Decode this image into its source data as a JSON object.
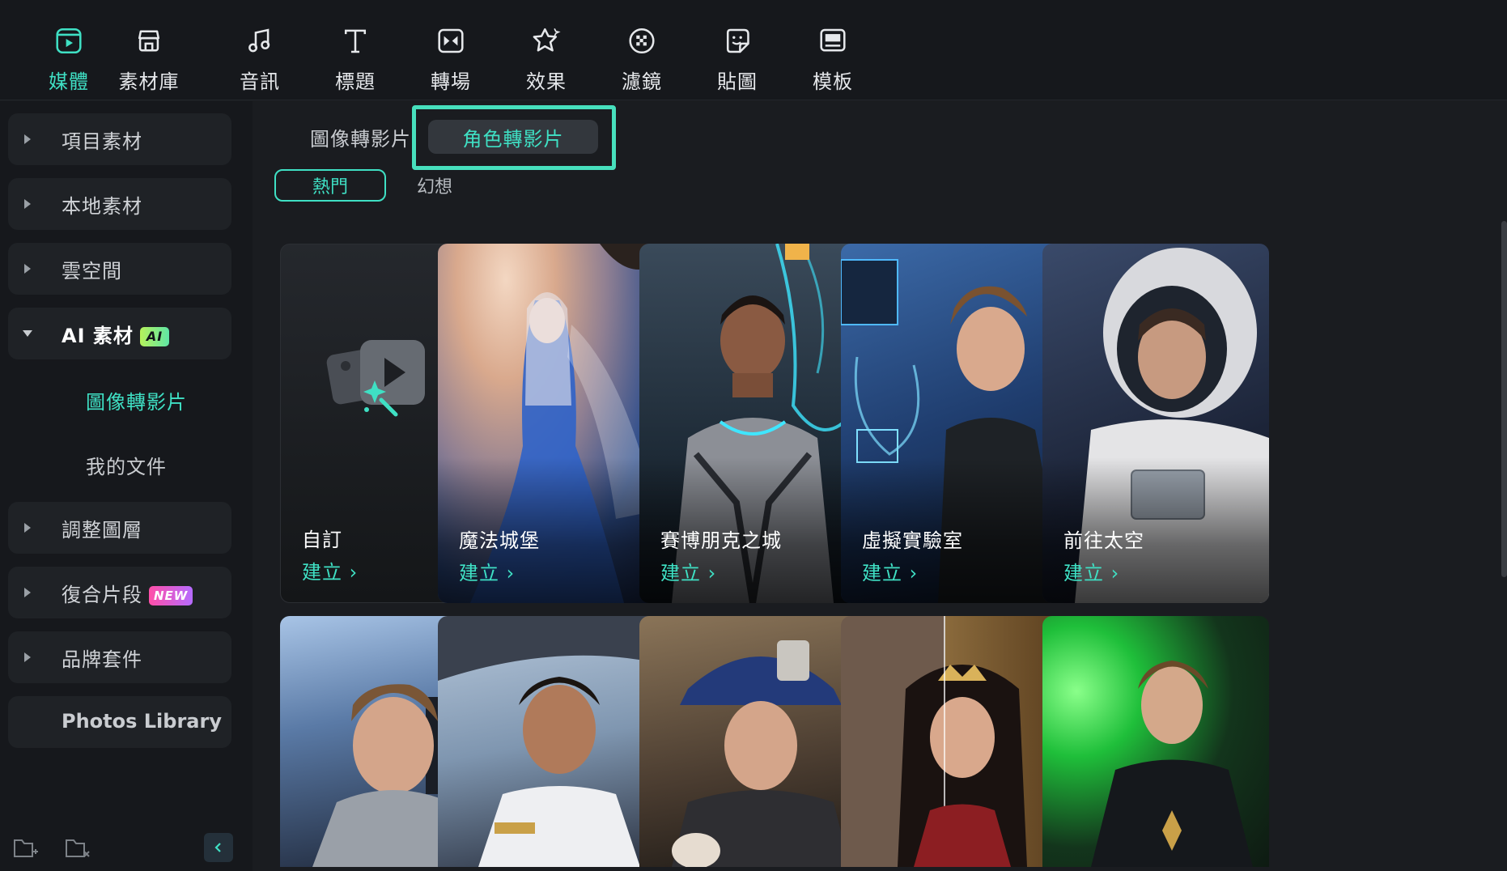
{
  "toolbar": {
    "items": [
      {
        "label": "媒體",
        "icon": "media-icon",
        "active": true
      },
      {
        "label": "素材庫",
        "icon": "store-icon"
      },
      {
        "label": "音訊",
        "icon": "music-note-icon"
      },
      {
        "label": "標題",
        "icon": "text-t-icon"
      },
      {
        "label": "轉場",
        "icon": "transition-icon"
      },
      {
        "label": "效果",
        "icon": "effects-star-icon"
      },
      {
        "label": "濾鏡",
        "icon": "filter-icon"
      },
      {
        "label": "貼圖",
        "icon": "sticker-icon"
      },
      {
        "label": "模板",
        "icon": "template-icon"
      }
    ]
  },
  "sidebar": {
    "items": [
      {
        "label": "項目素材"
      },
      {
        "label": "本地素材"
      },
      {
        "label": "雲空間"
      },
      {
        "label": "AI 素材",
        "badge": "AI"
      },
      {
        "label": "調整圖層"
      },
      {
        "label": "復合片段",
        "badge": "NEW"
      },
      {
        "label": "品牌套件"
      }
    ],
    "sub_items": [
      {
        "label": "圖像轉影片"
      },
      {
        "label": "我的文件"
      }
    ],
    "photos_library": "Photos Library"
  },
  "main": {
    "tabs": [
      {
        "label": "圖像轉影片"
      },
      {
        "label": "角色轉影片"
      }
    ],
    "chips": [
      {
        "label": "熱門"
      },
      {
        "label": "幻想"
      }
    ],
    "cards": [
      {
        "title": "自訂",
        "action": "建立 ›"
      },
      {
        "title": "魔法城堡",
        "action": "建立 ›"
      },
      {
        "title": "賽博朋克之城",
        "action": "建立 ›"
      },
      {
        "title": "虛擬實驗室",
        "action": "建立 ›"
      },
      {
        "title": "前往太空",
        "action": "建立 ›"
      }
    ]
  },
  "colors": {
    "accent": "#3fe0c4",
    "highlight_box": "#47e0bd",
    "background": "#1a1c20",
    "panel": "#16181c"
  }
}
